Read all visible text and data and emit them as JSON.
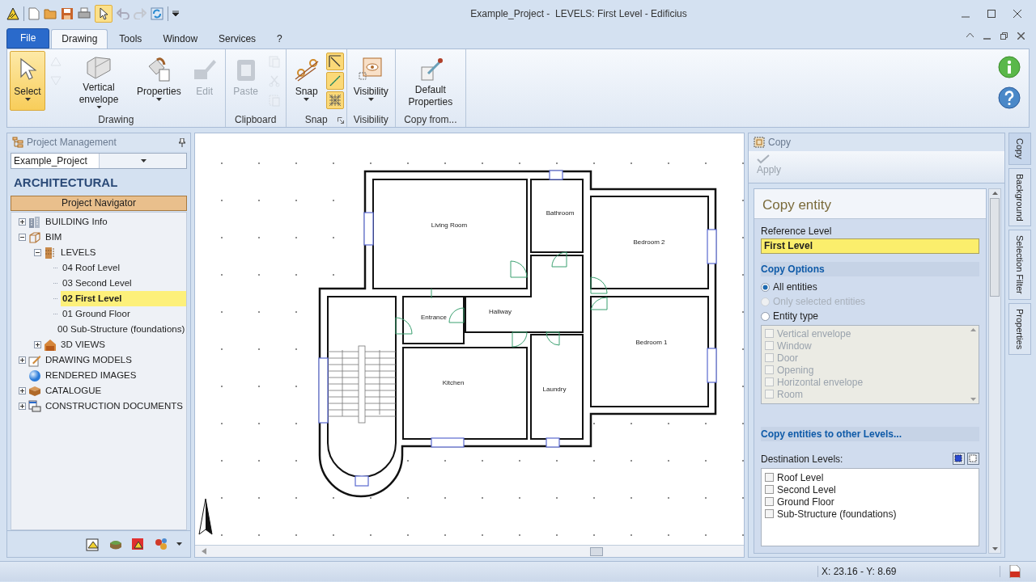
{
  "window": {
    "title": "Example_Project -  LEVELS: First Level - Edificius"
  },
  "ribbon_tabs": [
    {
      "label": "File",
      "kind": "file",
      "selected": false
    },
    {
      "label": "Drawing",
      "kind": "tab",
      "selected": true
    },
    {
      "label": "Tools",
      "kind": "tab",
      "selected": false
    },
    {
      "label": "Window",
      "kind": "tab",
      "selected": false
    },
    {
      "label": "Services",
      "kind": "tab",
      "selected": false
    },
    {
      "label": "?",
      "kind": "tab",
      "selected": false
    }
  ],
  "ribbon_groups": [
    {
      "label": "Drawing",
      "launcher": false,
      "buttons": [
        {
          "kind": "large",
          "label": "Select",
          "active": true,
          "disabled": false,
          "dropdown": true
        },
        {
          "kind": "stack",
          "items": [
            {
              "active": false,
              "disabled": true
            },
            {
              "active": false,
              "disabled": true
            }
          ]
        },
        {
          "kind": "large",
          "label": "Vertical envelope",
          "active": false,
          "disabled": false,
          "dropdown": true
        },
        {
          "kind": "large",
          "label": "Properties",
          "active": false,
          "disabled": false,
          "dropdown": true
        },
        {
          "kind": "large",
          "label": "Edit",
          "active": false,
          "disabled": true,
          "dropdown": false
        }
      ]
    },
    {
      "label": "Clipboard",
      "launcher": false,
      "buttons": [
        {
          "kind": "large",
          "label": "Paste",
          "active": false,
          "disabled": true,
          "dropdown": false
        },
        {
          "kind": "stack",
          "items": [
            {
              "active": false,
              "disabled": true
            },
            {
              "active": false,
              "disabled": true
            },
            {
              "active": false,
              "disabled": true
            }
          ]
        }
      ]
    },
    {
      "label": "Snap",
      "launcher": true,
      "buttons": [
        {
          "kind": "large",
          "label": "Snap",
          "active": false,
          "disabled": false,
          "dropdown": true
        },
        {
          "kind": "stack",
          "items": [
            {
              "active": true,
              "disabled": false
            },
            {
              "active": true,
              "disabled": false
            },
            {
              "active": true,
              "disabled": false
            }
          ]
        }
      ]
    },
    {
      "label": "Visibility",
      "launcher": false,
      "buttons": [
        {
          "kind": "large",
          "label": "Visibility",
          "active": false,
          "disabled": false,
          "dropdown": true
        }
      ]
    },
    {
      "label": "Copy from...",
      "launcher": false,
      "buttons": [
        {
          "kind": "large",
          "label": "Default Properties",
          "active": false,
          "disabled": false,
          "dropdown": false
        }
      ]
    }
  ],
  "project_panel": {
    "title": "Project Management",
    "project": "Example_Project",
    "heading": "ARCHITECTURAL",
    "navigator": "Project Navigator",
    "tree": [
      {
        "label": "BUILDING Info",
        "kind": "building",
        "expanded": false,
        "selected": false
      },
      {
        "label": "BIM",
        "kind": "bim",
        "expanded": true,
        "selected": false,
        "children": [
          {
            "label": "LEVELS",
            "kind": "levels",
            "expanded": true,
            "selected": false,
            "children": [
              {
                "label": "04 Roof Level",
                "kind": "level",
                "selected": false
              },
              {
                "label": "03 Second Level",
                "kind": "level",
                "selected": false
              },
              {
                "label": "02 First Level",
                "kind": "level",
                "selected": true
              },
              {
                "label": "01 Ground Floor",
                "kind": "level",
                "selected": false
              },
              {
                "label": "00 Sub-Structure (foundations)",
                "kind": "level",
                "selected": false
              }
            ]
          },
          {
            "label": "3D VIEWS",
            "kind": "views3d",
            "expanded": false,
            "selected": false
          }
        ]
      },
      {
        "label": "DRAWING MODELS",
        "kind": "models",
        "expanded": false,
        "selected": false
      },
      {
        "label": "RENDERED IMAGES",
        "kind": "renders",
        "selected": false
      },
      {
        "label": "CATALOGUE",
        "kind": "catalogue",
        "expanded": false,
        "selected": false
      },
      {
        "label": "CONSTRUCTION DOCUMENTS",
        "kind": "documents",
        "expanded": false,
        "selected": false
      }
    ]
  },
  "canvas": {
    "rooms": [
      "Living Room",
      "Bathroom",
      "Bedroom 2",
      "Entrance",
      "Hallway",
      "Bedroom 1",
      "Kitchen",
      "Laundry"
    ]
  },
  "copy_panel": {
    "title": "Copy",
    "apply": {
      "label": "Apply",
      "disabled": true
    },
    "heading": "Copy entity",
    "reference_label": "Reference Level",
    "reference_value": "First Level",
    "options_heading": "Copy Options",
    "modes": [
      {
        "label": "All entities",
        "selected": true,
        "disabled": false
      },
      {
        "label": "Only selected entities",
        "selected": false,
        "disabled": true
      },
      {
        "label": "Entity type",
        "selected": false,
        "disabled": false
      }
    ],
    "entity_list": {
      "disabled": true,
      "items": [
        {
          "label": "Vertical envelope",
          "checked": false
        },
        {
          "label": "Window",
          "checked": false
        },
        {
          "label": "Door",
          "checked": false
        },
        {
          "label": "Opening",
          "checked": false
        },
        {
          "label": "Horizontal envelope",
          "checked": false
        },
        {
          "label": "Room",
          "checked": false
        }
      ]
    },
    "levels_heading": "Copy entities to other Levels...",
    "destination_label": "Destination Levels:",
    "destinations": [
      {
        "label": "Roof Level",
        "checked": false
      },
      {
        "label": "Second Level",
        "checked": false
      },
      {
        "label": "Ground Floor",
        "checked": false
      },
      {
        "label": "Sub-Structure (foundations)",
        "checked": false
      }
    ]
  },
  "side_tabs": [
    {
      "label": "Copy",
      "selected": true
    },
    {
      "label": "Background",
      "selected": false
    },
    {
      "label": "Selection Filter",
      "selected": false
    },
    {
      "label": "Properties",
      "selected": false
    }
  ],
  "status_bar": {
    "coordinates": "X: 23.16 - Y: 8.69"
  }
}
